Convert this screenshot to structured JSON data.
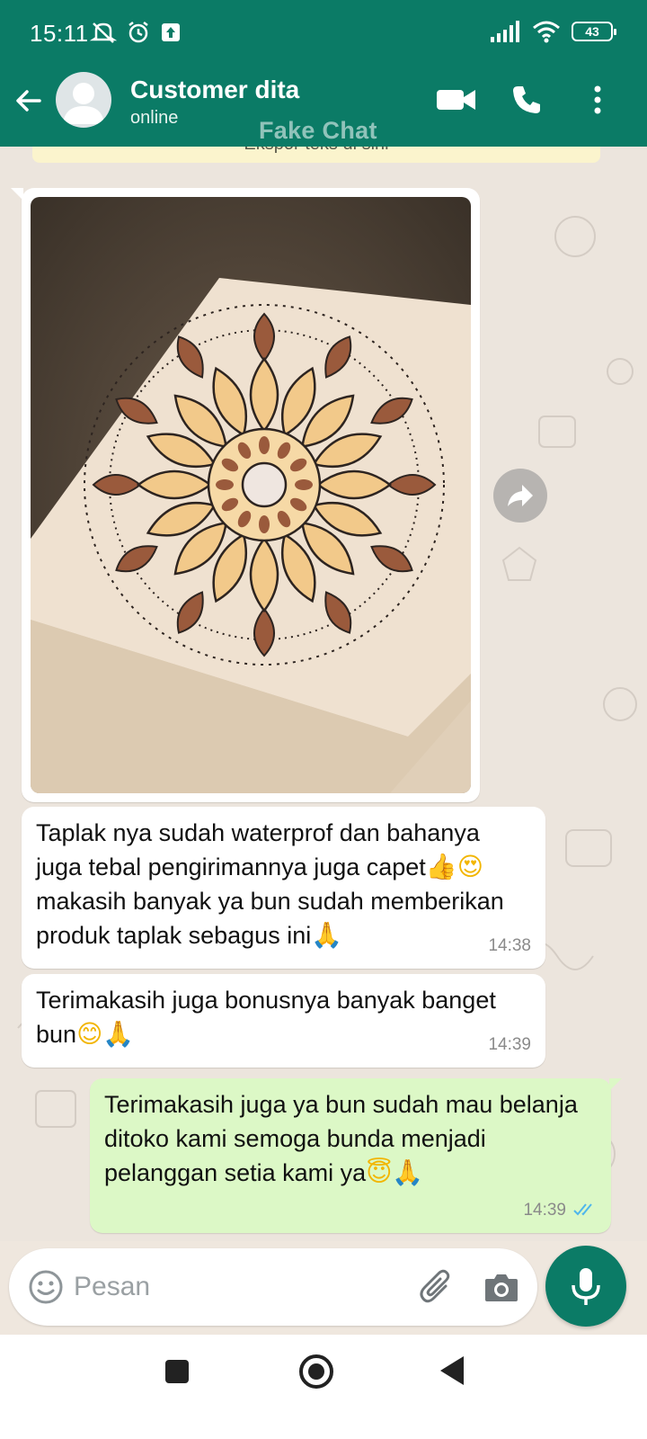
{
  "status_bar": {
    "time": "15:11",
    "battery": "43"
  },
  "header": {
    "contact_name": "Customer dita",
    "contact_status": "online",
    "watermark": "Fake Chat",
    "background_color": "#0b7b66"
  },
  "system_notice": {
    "text": "Ekspor teks di sini"
  },
  "messages": [
    {
      "direction": "incoming",
      "type": "image",
      "image_description": "mandala pattern tablecloth"
    },
    {
      "direction": "incoming",
      "type": "text",
      "text_parts": [
        "Taplak nya sudah waterprof dan bahanya juga tebal pengirimannya juga capet",
        "makasih banyak ya bun sudah memberikan produk taplak sebagus ini"
      ],
      "emojis": [
        "👍",
        "😍",
        "🙏"
      ],
      "time": "14:38"
    },
    {
      "direction": "incoming",
      "type": "text",
      "text_parts": [
        "Terimakasih juga bonusnya banyak banget bun"
      ],
      "emojis": [
        "😊",
        "🙏"
      ],
      "time": "14:39"
    },
    {
      "direction": "outgoing",
      "type": "text",
      "text_parts": [
        "Terimakasih juga ya bun sudah mau belanja ditoko kami semoga bunda menjadi pelanggan setia kami ya"
      ],
      "emojis": [
        "😇",
        "🙏"
      ],
      "time": "14:39",
      "read": true
    }
  ],
  "composer": {
    "placeholder": "Pesan"
  },
  "colors": {
    "brand_green": "#0b7b66",
    "outgoing_bubble": "#dcf8c6",
    "incoming_bubble": "#ffffff",
    "read_tick": "#4fb6ec"
  }
}
